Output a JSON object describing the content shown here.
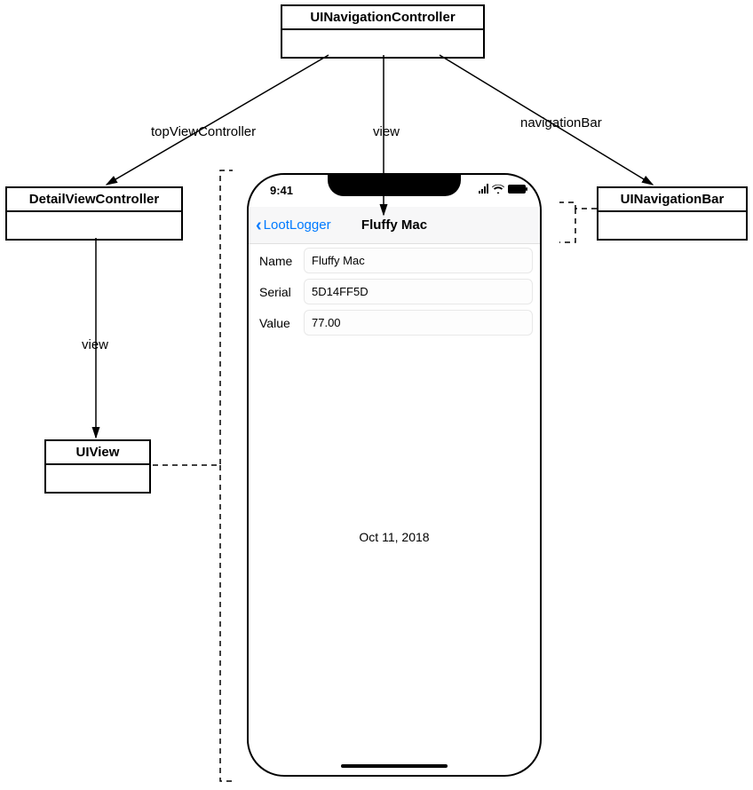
{
  "uml": {
    "navController": "UINavigationController",
    "detailVC": "DetailViewController",
    "uiview": "UIView",
    "navBar": "UINavigationBar"
  },
  "edges": {
    "topViewController": "topViewController",
    "viewTop": "view",
    "navigationBar": "navigationBar",
    "viewLeft": "view"
  },
  "phone": {
    "time": "9:41",
    "backLabel": "LootLogger",
    "title": "Fluffy Mac",
    "fields": {
      "nameLabel": "Name",
      "nameValue": "Fluffy Mac",
      "serialLabel": "Serial",
      "serialValue": "5D14FF5D",
      "valueLabel": "Value",
      "valueValue": "77.00"
    },
    "date": "Oct 11, 2018"
  }
}
